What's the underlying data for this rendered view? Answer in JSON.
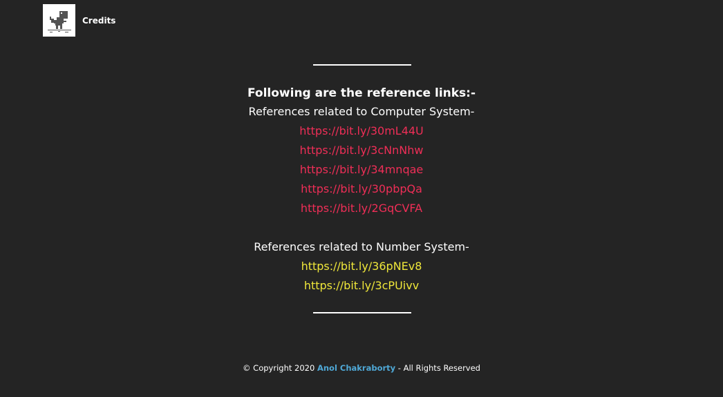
{
  "header": {
    "brand_label": "Credits",
    "logo_icon": "dino-icon"
  },
  "main": {
    "heading": "Following are the reference links:-",
    "computer_system": {
      "label": "References related to Computer System-",
      "links": [
        "https://bit.ly/30mL44U",
        "https://bit.ly/3cNnNhw",
        "https://bit.ly/34mnqae",
        "https://bit.ly/30pbpQa",
        "https://bit.ly/2GqCVFA"
      ],
      "link_color": "#ef2e57"
    },
    "number_system": {
      "label": "References related to Number System-",
      "links": [
        "https://bit.ly/36pNEv8",
        "https://bit.ly/3cPUivv"
      ],
      "link_color": "#efe73a"
    }
  },
  "footer": {
    "prefix": "© Copyright 2020 ",
    "author": "Anol Chakraborty",
    "suffix": " - All Rights Reserved",
    "author_color": "#4fa8d6"
  },
  "colors": {
    "background": "#242424",
    "text": "#ffffff"
  }
}
